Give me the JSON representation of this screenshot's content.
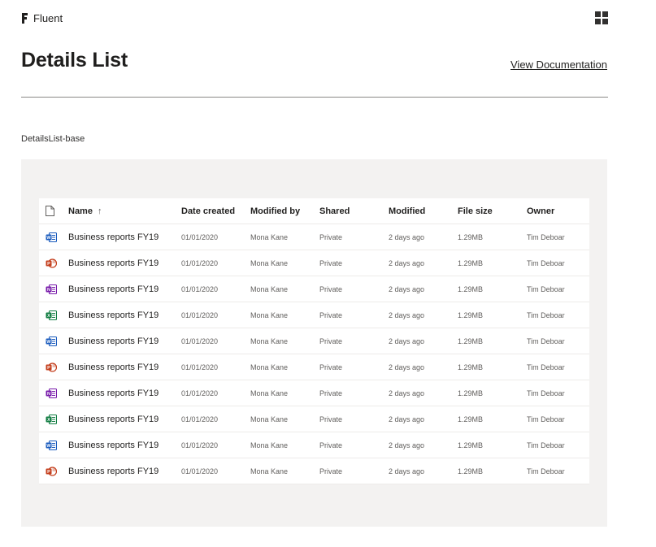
{
  "brand": {
    "name": "Fluent",
    "logo_icon": "fluent-logo-icon"
  },
  "app_launcher": {
    "icon": "app-grid-icon"
  },
  "page": {
    "title": "Details List",
    "doc_link": "View Documentation",
    "example_label": "DetailsList-base"
  },
  "list": {
    "columns": {
      "file_type": "file-icon",
      "name": "Name",
      "sort_indicator": "↑",
      "date": "Date created",
      "modified_by": "Modified by",
      "shared": "Shared",
      "modified": "Modified",
      "size": "File size",
      "owner": "Owner"
    },
    "rows": [
      {
        "type": "word",
        "name": "Business reports FY19",
        "date": "01/01/2020",
        "modified_by": "Mona Kane",
        "shared": "Private",
        "modified": "2 days ago",
        "size": "1.29MB",
        "owner": "Tim Deboar"
      },
      {
        "type": "powerpoint",
        "name": "Business reports FY19",
        "date": "01/01/2020",
        "modified_by": "Mona Kane",
        "shared": "Private",
        "modified": "2 days ago",
        "size": "1.29MB",
        "owner": "Tim Deboar"
      },
      {
        "type": "onenote",
        "name": "Business reports FY19",
        "date": "01/01/2020",
        "modified_by": "Mona Kane",
        "shared": "Private",
        "modified": "2 days ago",
        "size": "1.29MB",
        "owner": "Tim Deboar"
      },
      {
        "type": "excel",
        "name": "Business reports FY19",
        "date": "01/01/2020",
        "modified_by": "Mona Kane",
        "shared": "Private",
        "modified": "2 days ago",
        "size": "1.29MB",
        "owner": "Tim Deboar"
      },
      {
        "type": "word",
        "name": "Business reports FY19",
        "date": "01/01/2020",
        "modified_by": "Mona Kane",
        "shared": "Private",
        "modified": "2 days ago",
        "size": "1.29MB",
        "owner": "Tim Deboar"
      },
      {
        "type": "powerpoint",
        "name": "Business reports FY19",
        "date": "01/01/2020",
        "modified_by": "Mona Kane",
        "shared": "Private",
        "modified": "2 days ago",
        "size": "1.29MB",
        "owner": "Tim Deboar"
      },
      {
        "type": "onenote",
        "name": "Business reports FY19",
        "date": "01/01/2020",
        "modified_by": "Mona Kane",
        "shared": "Private",
        "modified": "2 days ago",
        "size": "1.29MB",
        "owner": "Tim Deboar"
      },
      {
        "type": "excel",
        "name": "Business reports FY19",
        "date": "01/01/2020",
        "modified_by": "Mona Kane",
        "shared": "Private",
        "modified": "2 days ago",
        "size": "1.29MB",
        "owner": "Tim Deboar"
      },
      {
        "type": "word",
        "name": "Business reports FY19",
        "date": "01/01/2020",
        "modified_by": "Mona Kane",
        "shared": "Private",
        "modified": "2 days ago",
        "size": "1.29MB",
        "owner": "Tim Deboar"
      },
      {
        "type": "powerpoint",
        "name": "Business reports FY19",
        "date": "01/01/2020",
        "modified_by": "Mona Kane",
        "shared": "Private",
        "modified": "2 days ago",
        "size": "1.29MB",
        "owner": "Tim Deboar"
      }
    ]
  },
  "colors": {
    "word": "#185abd",
    "powerpoint": "#c43e1c",
    "onenote": "#7719aa",
    "excel": "#107c41",
    "panel": "#f3f2f1",
    "divider": "#edebe9"
  }
}
